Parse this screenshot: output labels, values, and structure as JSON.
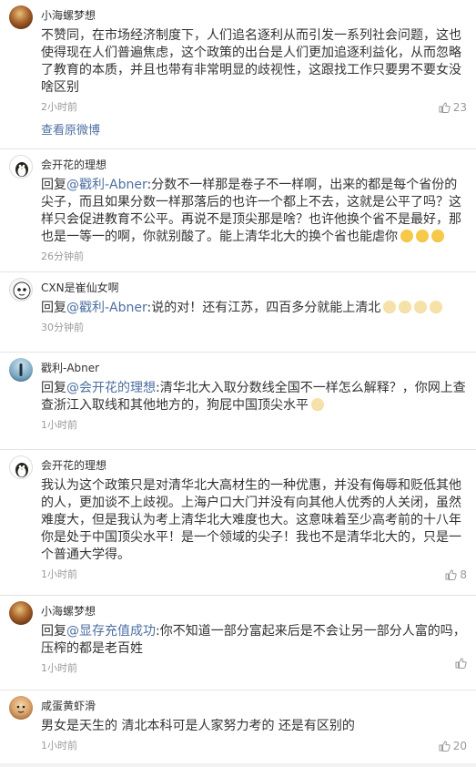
{
  "comments": [
    {
      "user": "小海螺梦想",
      "text": "不赞同，在市场经济制度下，人们追名逐利从而引发一系列社会问题，这也使得现在人们普遍焦虑，这个政策的出台是人们更加追逐利益化，从而忽略了教育的本质，并且也带有非常明显的歧视性，这跟找工作只要男不要女没啥区别",
      "time": "2小时前",
      "likes": "23",
      "view_original": "查看原微博"
    },
    {
      "user": "会开花的理想",
      "reply_prefix": "回复",
      "reply_to": "@戳利-Abner",
      "text": ":分数不一样那是卷子不一样啊，出来的都是每个省份的尖子，而且如果分数一样那落后的也许一个都上不去，这就是公平了吗？这样只会促进教育不公平。再说不是顶尖那是啥？也许他换个省不是最好，那也是一等一的啊，你就别酸了。能上清华北大的换个省也能虐你",
      "time": "26分钟前"
    },
    {
      "user": "CXN是崔仙女啊",
      "reply_prefix": "回复",
      "reply_to": "@戳利-Abner",
      "text": ":说的对！还有江苏，四百多分就能上清北",
      "time": "30分钟前"
    },
    {
      "user": "戳利-Abner",
      "reply_prefix": "回复",
      "reply_to": "@会开花的理想",
      "text": ":清华北大入取分数线全国不一样怎么解释？，你网上查查浙江入取线和其他地方的，狗屁中国顶尖水平",
      "time": "1小时前"
    },
    {
      "user": "会开花的理想",
      "text": "我认为这个政策只是对清华北大高材生的一种优惠，并没有侮辱和贬低其他的人，更加谈不上歧视。上海户口大门并没有向其他人优秀的人关闭，虽然难度大，但是我认为考上清华北大难度也大。这意味着至少高考前的十八年你是处于中国顶尖水平！是一个领域的尖子！我也不是清华北大的，只是一个普通大学得。",
      "time": "1小时前",
      "likes": "8"
    },
    {
      "user": "小海螺梦想",
      "reply_prefix": "回复",
      "reply_to": "@显存充值成功",
      "text": ":你不知道一部分富起来后是不会让另一部分人富的吗，压榨的都是老百姓",
      "time": "1小时前"
    },
    {
      "user": "咸蛋黄虾滑",
      "text": "男女是天生的 清北本科可是人家努力考的 还是有区别的",
      "time": "1小时前",
      "likes": "20"
    }
  ],
  "colors": {
    "link": "#4d6fa2",
    "meta": "#9a9a9a",
    "background": "#f2f2f2"
  },
  "icons": {
    "like": "thumbs-up-icon",
    "emoji_sweat": "sweat-smile-emoji-icon",
    "emoji_cat": "cat-face-emoji-icon"
  }
}
